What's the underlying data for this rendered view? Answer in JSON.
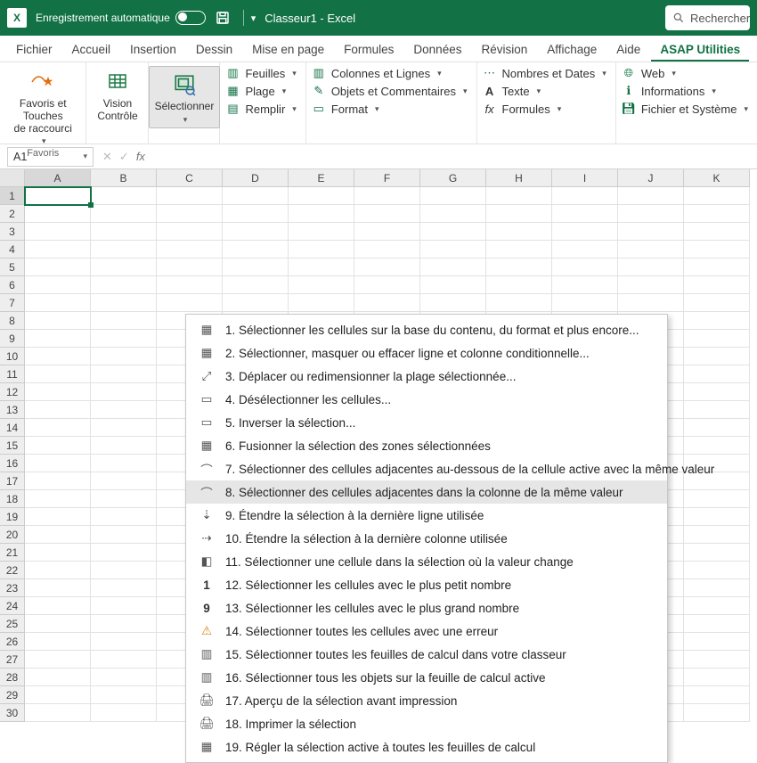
{
  "titlebar": {
    "autosave": "Enregistrement automatique",
    "workbook": "Classeur1",
    "app": "Excel",
    "title_full": "Classeur1  -  Excel",
    "search": "Rechercher"
  },
  "tabs": [
    "Fichier",
    "Accueil",
    "Insertion",
    "Dessin",
    "Mise en page",
    "Formules",
    "Données",
    "Révision",
    "Affichage",
    "Aide",
    "ASAP Utilities"
  ],
  "active_tab": "ASAP Utilities",
  "ribbon": {
    "favoris": {
      "btn": "Favoris et Touches\nde raccourci",
      "label": "Favoris"
    },
    "vision": "Vision\nContrôle",
    "select": "Sélectionner",
    "col1": {
      "feuilles": "Feuilles",
      "plage": "Plage",
      "remplir": "Remplir"
    },
    "col2": {
      "cl": "Colonnes et Lignes",
      "oc": "Objets et Commentaires",
      "format": "Format"
    },
    "col3": {
      "nd": "Nombres et Dates",
      "texte": "Texte",
      "formules": "Formules"
    },
    "col4": {
      "web": "Web",
      "info": "Informations",
      "fs": "Fichier et Système"
    }
  },
  "name_box": "A1",
  "columns": [
    "A",
    "B",
    "C",
    "D",
    "E",
    "F",
    "G",
    "H",
    "I",
    "J",
    "K"
  ],
  "rows_count": 30,
  "dropdown_hover_index": 7,
  "dropdown": [
    "1.  Sélectionner les cellules sur la base du contenu, du format et plus encore...",
    "2.  Sélectionner, masquer ou effacer ligne et colonne conditionnelle...",
    "3.  Déplacer ou redimensionner la plage sélectionnée...",
    "4.  Désélectionner les cellules...",
    "5.  Inverser la sélection...",
    "6.  Fusionner la sélection des zones sélectionnées",
    "7.  Sélectionner des cellules adjacentes au-dessous de la cellule active avec la même valeur",
    "8.  Sélectionner des cellules adjacentes dans la colonne de la même valeur",
    "9.  Étendre la sélection à la dernière ligne utilisée",
    "10.  Étendre la sélection à la dernière colonne utilisée",
    "11.  Sélectionner une cellule dans la sélection où la valeur change",
    "12.  Sélectionner les cellules avec le plus petit nombre",
    "13.  Sélectionner les cellules avec le plus grand nombre",
    "14.  Sélectionner toutes les cellules avec une erreur",
    "15.  Sélectionner toutes les feuilles de calcul dans votre classeur",
    "16.  Sélectionner tous les objets sur la feuille de calcul active",
    "17.  Aperçu de la sélection avant impression",
    "18.  Imprimer la sélection",
    "19.  Régler la sélection active à toutes les feuilles de calcul"
  ]
}
